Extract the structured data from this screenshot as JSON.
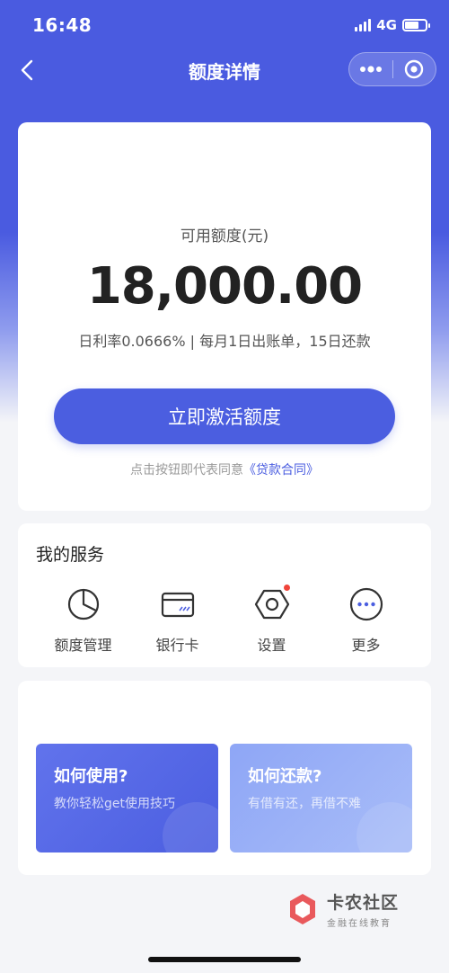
{
  "status_bar": {
    "time": "16:48",
    "network": "4G"
  },
  "nav": {
    "title": "额度详情"
  },
  "quota": {
    "label": "可用额度(元)",
    "amount": "18,000.00",
    "terms": "日利率0.0666% | 每月1日出账单，15日还款",
    "activate_label": "立即激活额度",
    "agree_prefix": "点击按钮即代表同意",
    "contract_link": "《贷款合同》"
  },
  "services": {
    "title": "我的服务",
    "items": [
      {
        "label": "额度管理",
        "icon": "pie-chart-icon"
      },
      {
        "label": "银行卡",
        "icon": "bank-card-icon"
      },
      {
        "label": "设置",
        "icon": "settings-hexagon-icon"
      },
      {
        "label": "更多",
        "icon": "more-circle-icon"
      }
    ]
  },
  "guides": [
    {
      "title": "如何使用?",
      "subtitle": "教你轻松get使用技巧"
    },
    {
      "title": "如何还款?",
      "subtitle": "有借有还，再借不难"
    }
  ],
  "watermark": {
    "title": "卡农社区",
    "subtitle": "金融在线教育"
  },
  "colors": {
    "primary": "#4b5ee0",
    "badge_red": "#f0443a"
  }
}
